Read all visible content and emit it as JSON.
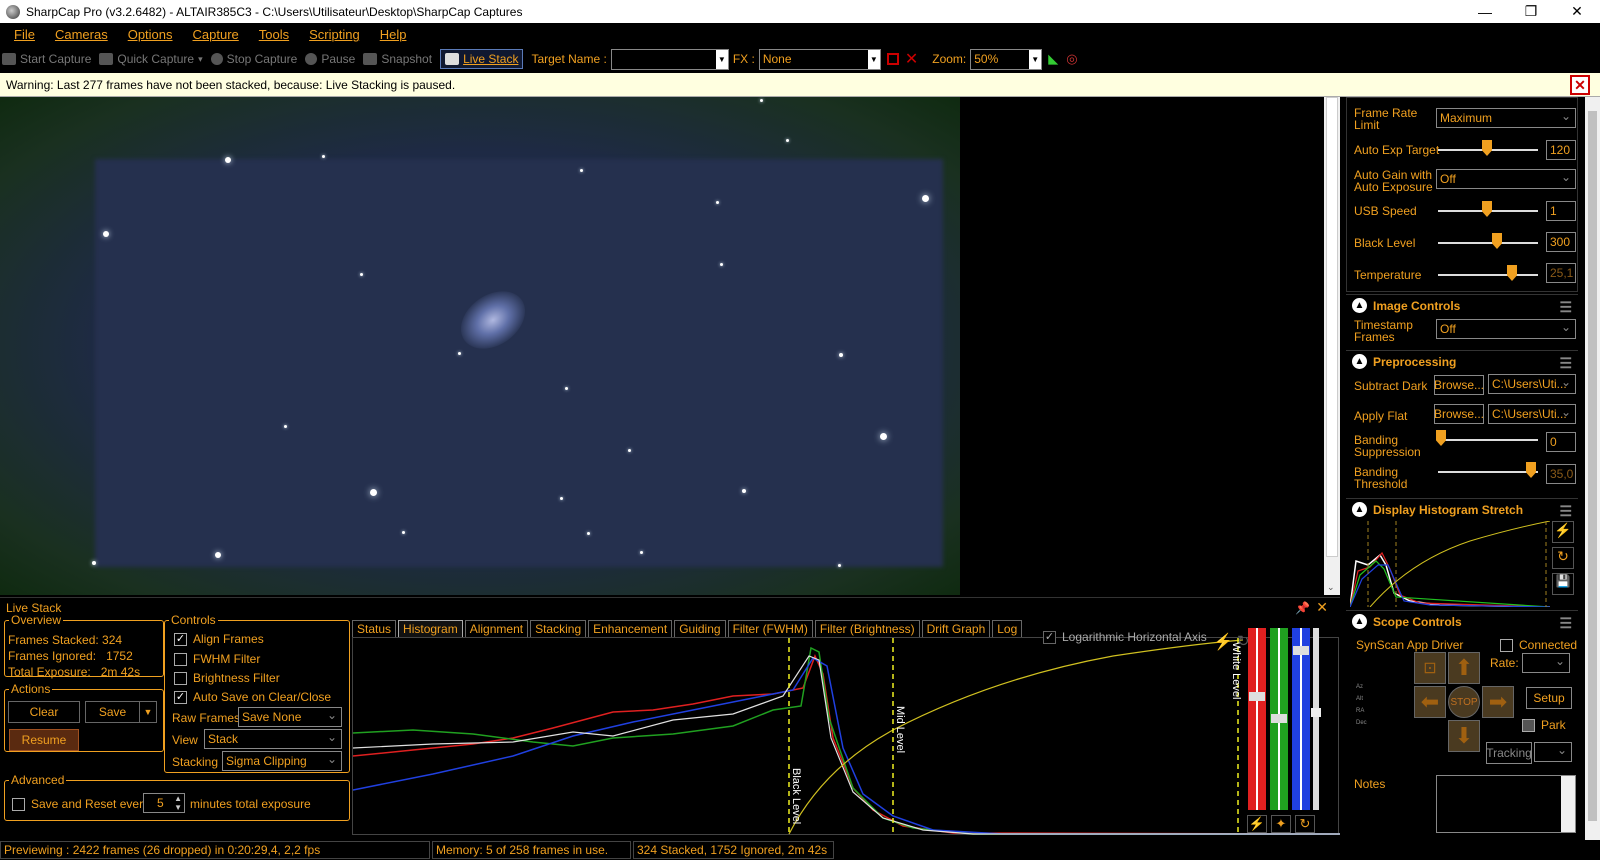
{
  "window": {
    "title": "SharpCap Pro (v3.2.6482) - ALTAIR385C3 - C:\\Users\\Utilisateur\\Desktop\\SharpCap Captures",
    "minimize": "—",
    "maximize": "❐",
    "close": "✕"
  },
  "menu": [
    "File",
    "Cameras",
    "Options",
    "Capture",
    "Tools",
    "Scripting",
    "Help"
  ],
  "toolbar": {
    "start_capture": "Start Capture",
    "quick_capture": "Quick Capture",
    "stop_capture": "Stop Capture",
    "pause": "Pause",
    "snapshot": "Snapshot",
    "live_stack": "Live Stack",
    "target_name_label": "Target Name :",
    "target_name_value": "",
    "fx_label": "FX :",
    "fx_value": "None",
    "zoom_label": "Zoom:",
    "zoom_value": "50%"
  },
  "warning": "Warning: Last 277 frames have not been stacked, because: Live Stacking is paused.",
  "livestack": {
    "title": "Live Stack",
    "overview_legend": "Overview",
    "frames_stacked_label": "Frames Stacked:",
    "frames_stacked": "324",
    "frames_ignored_label": "Frames Ignored:",
    "frames_ignored": "1752",
    "total_exposure_label": "Total Exposure:",
    "total_exposure": "2m 42s",
    "actions_legend": "Actions",
    "clear": "Clear",
    "save": "Save",
    "resume": "Resume",
    "controls_legend": "Controls",
    "align_frames": "Align Frames",
    "fwhm_filter": "FWHM Filter",
    "brightness_filter": "Brightness Filter",
    "auto_save": "Auto Save on Clear/Close",
    "raw_frames_label": "Raw Frames",
    "raw_frames_value": "Save None",
    "view_label": "View",
    "view_value": "Stack",
    "stacking_label": "Stacking",
    "stacking_value": "Sigma Clipping",
    "advanced_legend": "Advanced",
    "save_reset_label": "Save and Reset every",
    "save_reset_value": "5",
    "save_reset_suffix": "minutes total exposure",
    "tabs": [
      "Status",
      "Histogram",
      "Alignment",
      "Stacking",
      "Enhancement",
      "Guiding",
      "Filter (FWHM)",
      "Filter (Brightness)",
      "Drift Graph",
      "Log"
    ],
    "log_axis_label": "Logarithmic Horizontal Axis",
    "black_level_marker": "Black Level",
    "mid_level_marker": "Mid Level",
    "white_level_marker": "White Level"
  },
  "status": {
    "preview": "Previewing : 2422 frames (26 dropped) in 0:20:29,4, 2,2 fps",
    "memory": "Memory: 5 of 258 frames in use.",
    "stack": "324 Stacked, 1752 Ignored, 2m 42s"
  },
  "camera_controls": {
    "frame_rate_label": "Frame Rate Limit",
    "frame_rate_value": "Maximum",
    "auto_exp_target_label": "Auto Exp Target",
    "auto_exp_target_value": "120",
    "auto_gain_label": "Auto Gain with Auto Exposure",
    "auto_gain_value": "Off",
    "usb_speed_label": "USB Speed",
    "usb_speed_value": "1",
    "black_level_label": "Black Level",
    "black_level_value": "300",
    "temperature_label": "Temperature",
    "temperature_value": "25,1"
  },
  "image_controls": {
    "title": "Image Controls",
    "timestamp_label": "Timestamp Frames",
    "timestamp_value": "Off"
  },
  "preprocessing": {
    "title": "Preprocessing",
    "subtract_dark_label": "Subtract Dark",
    "subtract_dark_browse": "Browse...",
    "subtract_dark_path": "C:\\Users\\Uti...",
    "apply_flat_label": "Apply Flat",
    "apply_flat_browse": "Browse...",
    "apply_flat_path": "C:\\Users\\Uti...",
    "banding_suppression_label": "Banding Suppression",
    "banding_suppression_value": "0",
    "banding_threshold_label": "Banding Threshold",
    "banding_threshold_value": "35,0"
  },
  "display_histogram": {
    "title": "Display Histogram Stretch"
  },
  "scope_controls": {
    "title": "Scope Controls",
    "driver": "SynScan App Driver",
    "connected": "Connected",
    "rate_label": "Rate:",
    "rate_value": "",
    "stop": "STOP",
    "setup": "Setup",
    "park": "Park",
    "tracking": "Tracking",
    "coords": [
      "Az",
      "Alt",
      "RA",
      "Dec"
    ]
  },
  "notes": {
    "label": "Notes"
  },
  "colors": {
    "accent": "#f0a020",
    "warning_bg": "#ffffe0"
  }
}
